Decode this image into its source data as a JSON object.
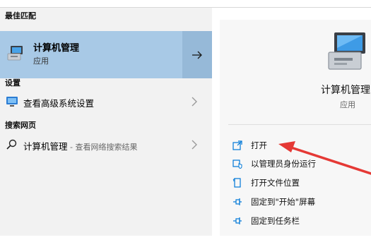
{
  "sections": {
    "best_match": "最佳匹配",
    "settings": "设置",
    "web": "搜索网页"
  },
  "best_match": {
    "title": "计算机管理",
    "subtitle": "应用",
    "icon": "computer-management-icon",
    "arrow_icon": "arrow-right-icon"
  },
  "settings_items": [
    {
      "label": "查看高级系统设置",
      "icon": "monitor-icon"
    }
  ],
  "web_items": [
    {
      "label": "计算机管理",
      "hint": " - 查看网络搜索结果",
      "icon": "search-icon"
    }
  ],
  "detail": {
    "title": "计算机管理",
    "subtitle": "应用",
    "actions": [
      {
        "label": "打开",
        "icon": "open-icon"
      },
      {
        "label": "以管理员身份运行",
        "icon": "run-as-admin-icon"
      },
      {
        "label": "打开文件位置",
        "icon": "file-location-icon"
      },
      {
        "label": "固定到\"开始\"屏幕",
        "icon": "pin-icon"
      },
      {
        "label": "固定到任务栏",
        "icon": "pin-icon"
      }
    ]
  },
  "colors": {
    "accent": "#0078d7",
    "selection": "#a8c9e6",
    "annotation_arrow": "#e53935"
  }
}
